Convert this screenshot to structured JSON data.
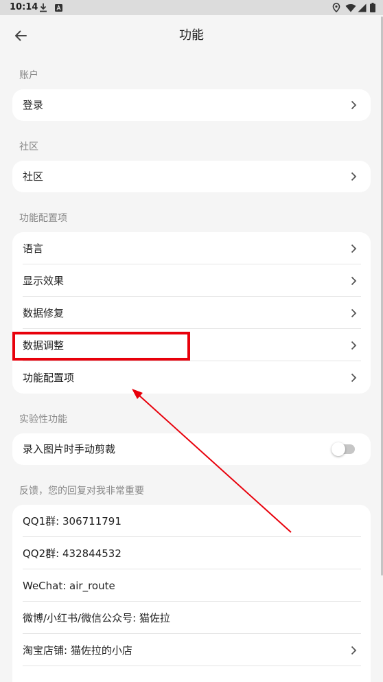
{
  "status_bar": {
    "time": "10:14",
    "left_icons": [
      "download-icon",
      "app-notification-icon"
    ],
    "right_icons": [
      "location-icon",
      "wifi-icon",
      "signal-icon",
      "battery-icon"
    ]
  },
  "app_bar": {
    "back_icon": "arrow-back-icon",
    "title": "功能"
  },
  "sections": [
    {
      "header": "账户",
      "items": [
        {
          "label": "登录",
          "chevron": true
        }
      ]
    },
    {
      "header": "社区",
      "items": [
        {
          "label": "社区",
          "chevron": true
        }
      ]
    },
    {
      "header": "功能配置项",
      "items": [
        {
          "label": "语言",
          "chevron": true
        },
        {
          "label": "显示效果",
          "chevron": true
        },
        {
          "label": "数据修复",
          "chevron": true
        },
        {
          "label": "数据调整",
          "chevron": true,
          "highlighted": true
        },
        {
          "label": "功能配置项",
          "chevron": true
        }
      ]
    },
    {
      "header": "实验性功能",
      "items": [
        {
          "label": "录入图片时手动剪裁",
          "toggle": {
            "checked": false
          }
        }
      ]
    },
    {
      "header": "反馈，您的回复对我非常重要",
      "items": [
        {
          "label": "QQ1群: 306711791"
        },
        {
          "label": "QQ2群: 432844532"
        },
        {
          "label": "WeChat: air_route"
        },
        {
          "label": "微博/小红书/微信公众号: 猫佐拉"
        },
        {
          "label": "淘宝店铺: 猫佐拉的小店",
          "chevron": true
        }
      ]
    }
  ],
  "annotation": {
    "highlight_box_color": "#e8000b",
    "arrow_color": "#e8000b"
  },
  "colors": {
    "page_background": "#f5f5f5",
    "status_bar_background": "#dcdcdc",
    "card_background": "#ffffff",
    "section_header_text": "#888888",
    "row_text": "#222222"
  }
}
